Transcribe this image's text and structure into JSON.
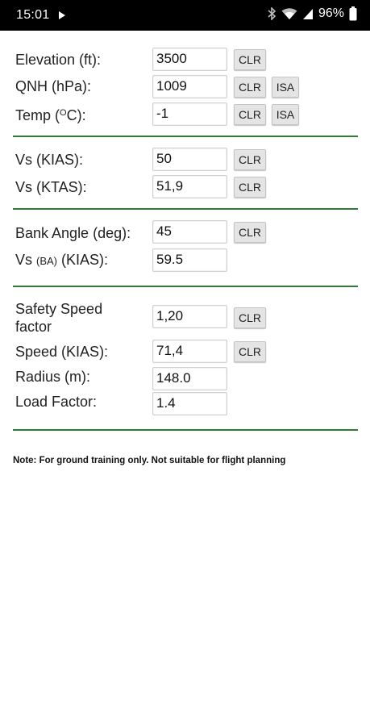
{
  "status_bar": {
    "time": "15:01",
    "battery": "96%"
  },
  "section1": {
    "elevation": {
      "label": "Elevation (ft):",
      "value": "3500",
      "clr": "CLR"
    },
    "qnh": {
      "label": "QNH (hPa):",
      "value": "1009",
      "clr": "CLR",
      "isa": "ISA"
    },
    "temp": {
      "label_prefix": "Temp (",
      "label_sup": "O",
      "label_suffix": "C):",
      "value": "-1",
      "clr": "CLR",
      "isa": "ISA"
    }
  },
  "section2": {
    "vs_kias": {
      "label": "Vs (KIAS):",
      "value": "50",
      "clr": "CLR"
    },
    "vs_ktas": {
      "label": "Vs (KTAS):",
      "value": "51,9",
      "clr": "CLR"
    }
  },
  "section3": {
    "bank_angle": {
      "label": "Bank Angle (deg):",
      "value": "45",
      "clr": "CLR"
    },
    "vs_ba": {
      "label_prefix": "Vs ",
      "label_small": "(BA)",
      "label_suffix": " (KIAS):",
      "value": "59.5"
    }
  },
  "section4": {
    "safety_speed": {
      "label_line1": "Safety Speed",
      "label_line2": "factor",
      "value": "1,20",
      "clr": "CLR"
    },
    "speed": {
      "label": "Speed (KIAS):",
      "value": "71,4",
      "clr": "CLR"
    },
    "radius": {
      "label": "Radius (m):",
      "value": "148.0"
    },
    "load_factor": {
      "label": "Load Factor:",
      "value": "1.4"
    }
  },
  "note": "Note: For ground training only. Not suitable for flight planning",
  "colors": {
    "divider": "#2e7d32",
    "status_bar": "#000000",
    "button": "#e4e4e4"
  }
}
